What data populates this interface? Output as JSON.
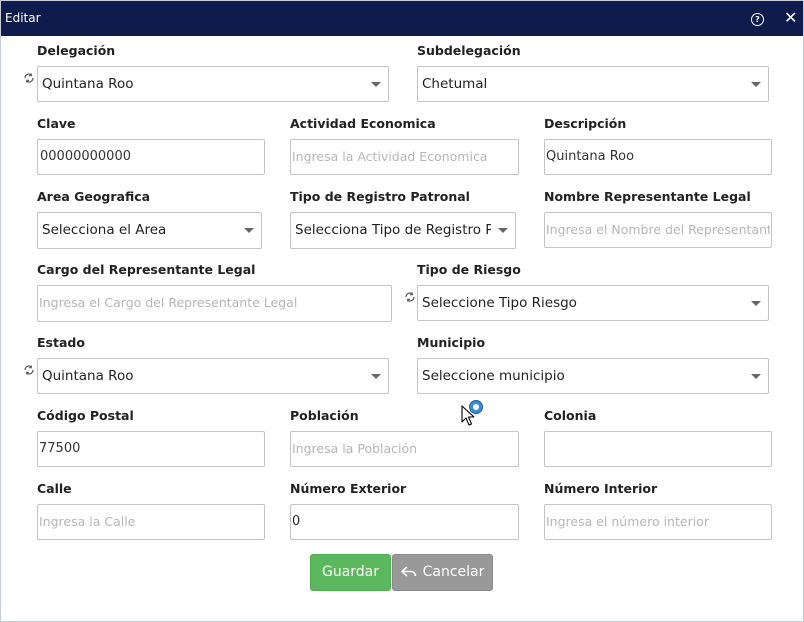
{
  "dialog": {
    "title": "Editar"
  },
  "fields": {
    "delegacion": {
      "label": "Delegación",
      "value": "Quintana Roo"
    },
    "subdelegacion": {
      "label": "Subdelegación",
      "value": "Chetumal"
    },
    "clave": {
      "label": "Clave",
      "value": "00000000000"
    },
    "actividad": {
      "label": "Actividad Economica",
      "placeholder": "Ingresa la Actividad Economica"
    },
    "descripcion": {
      "label": "Descripción",
      "value": "Quintana Roo"
    },
    "area": {
      "label": "Area Geografica",
      "value": "Selecciona el Area"
    },
    "tipo_registro": {
      "label": "Tipo de Registro Patronal",
      "value": "Selecciona Tipo de Registro P"
    },
    "representante": {
      "label": "Nombre Representante Legal",
      "placeholder": "Ingresa el Nombre del Representante"
    },
    "cargo": {
      "label": "Cargo del Representante Legal",
      "placeholder": "Ingresa el Cargo del Representante Legal"
    },
    "tipo_riesgo": {
      "label": "Tipo de Riesgo",
      "value": "Seleccione Tipo Riesgo"
    },
    "estado": {
      "label": "Estado",
      "value": "Quintana Roo"
    },
    "municipio": {
      "label": "Municipio",
      "value": "Seleccione municipio"
    },
    "codigo_postal": {
      "label": "Código Postal",
      "value": "77500"
    },
    "poblacion": {
      "label": "Población",
      "placeholder": "Ingresa la Población"
    },
    "colonia": {
      "label": "Colonia",
      "value": ""
    },
    "calle": {
      "label": "Calle",
      "placeholder": "Ingresa la Calle"
    },
    "num_exterior": {
      "label": "Número Exterior",
      "value": "0"
    },
    "num_interior": {
      "label": "Número Interior",
      "placeholder": "Ingresa el número interior"
    }
  },
  "buttons": {
    "save": "Guardar",
    "cancel": "Cancelar"
  },
  "colors": {
    "titlebar": "#0e1b4d",
    "save": "#5cb85c",
    "cancel": "#999999"
  },
  "icons": [
    "help-icon",
    "close-icon",
    "refresh-icon",
    "reply-icon",
    "cursor-icon"
  ]
}
